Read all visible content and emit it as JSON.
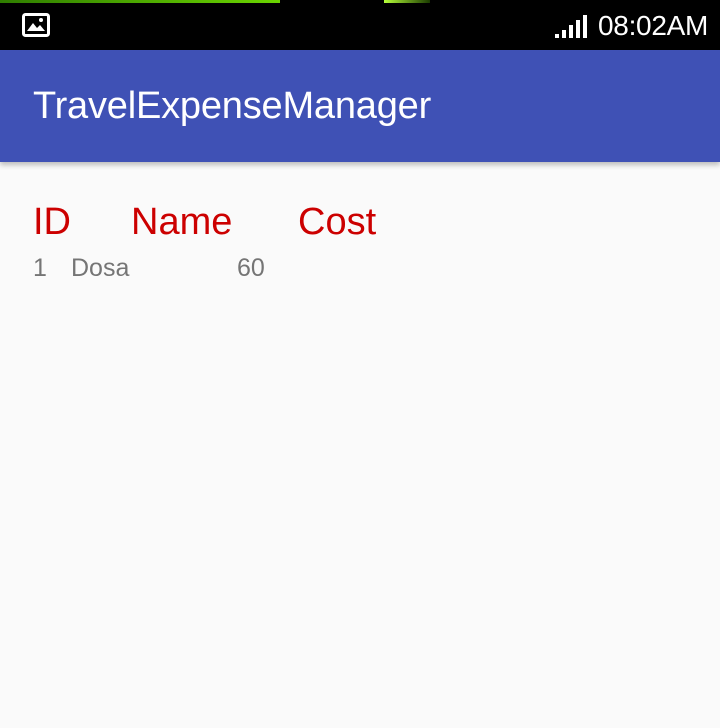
{
  "status_bar": {
    "time": "08:02AM",
    "icons": [
      "gallery-notification-icon",
      "signal-strength-icon"
    ]
  },
  "app_bar": {
    "title": "TravelExpenseManager"
  },
  "table": {
    "headers": {
      "id": "ID",
      "name": "Name",
      "cost": "Cost"
    },
    "rows": [
      {
        "id": "1",
        "name": "Dosa",
        "cost": "60"
      }
    ]
  },
  "colors": {
    "app_bar": "#3f51b5",
    "header_text": "#cc0000",
    "row_text": "#757575",
    "background": "#fafafa"
  }
}
